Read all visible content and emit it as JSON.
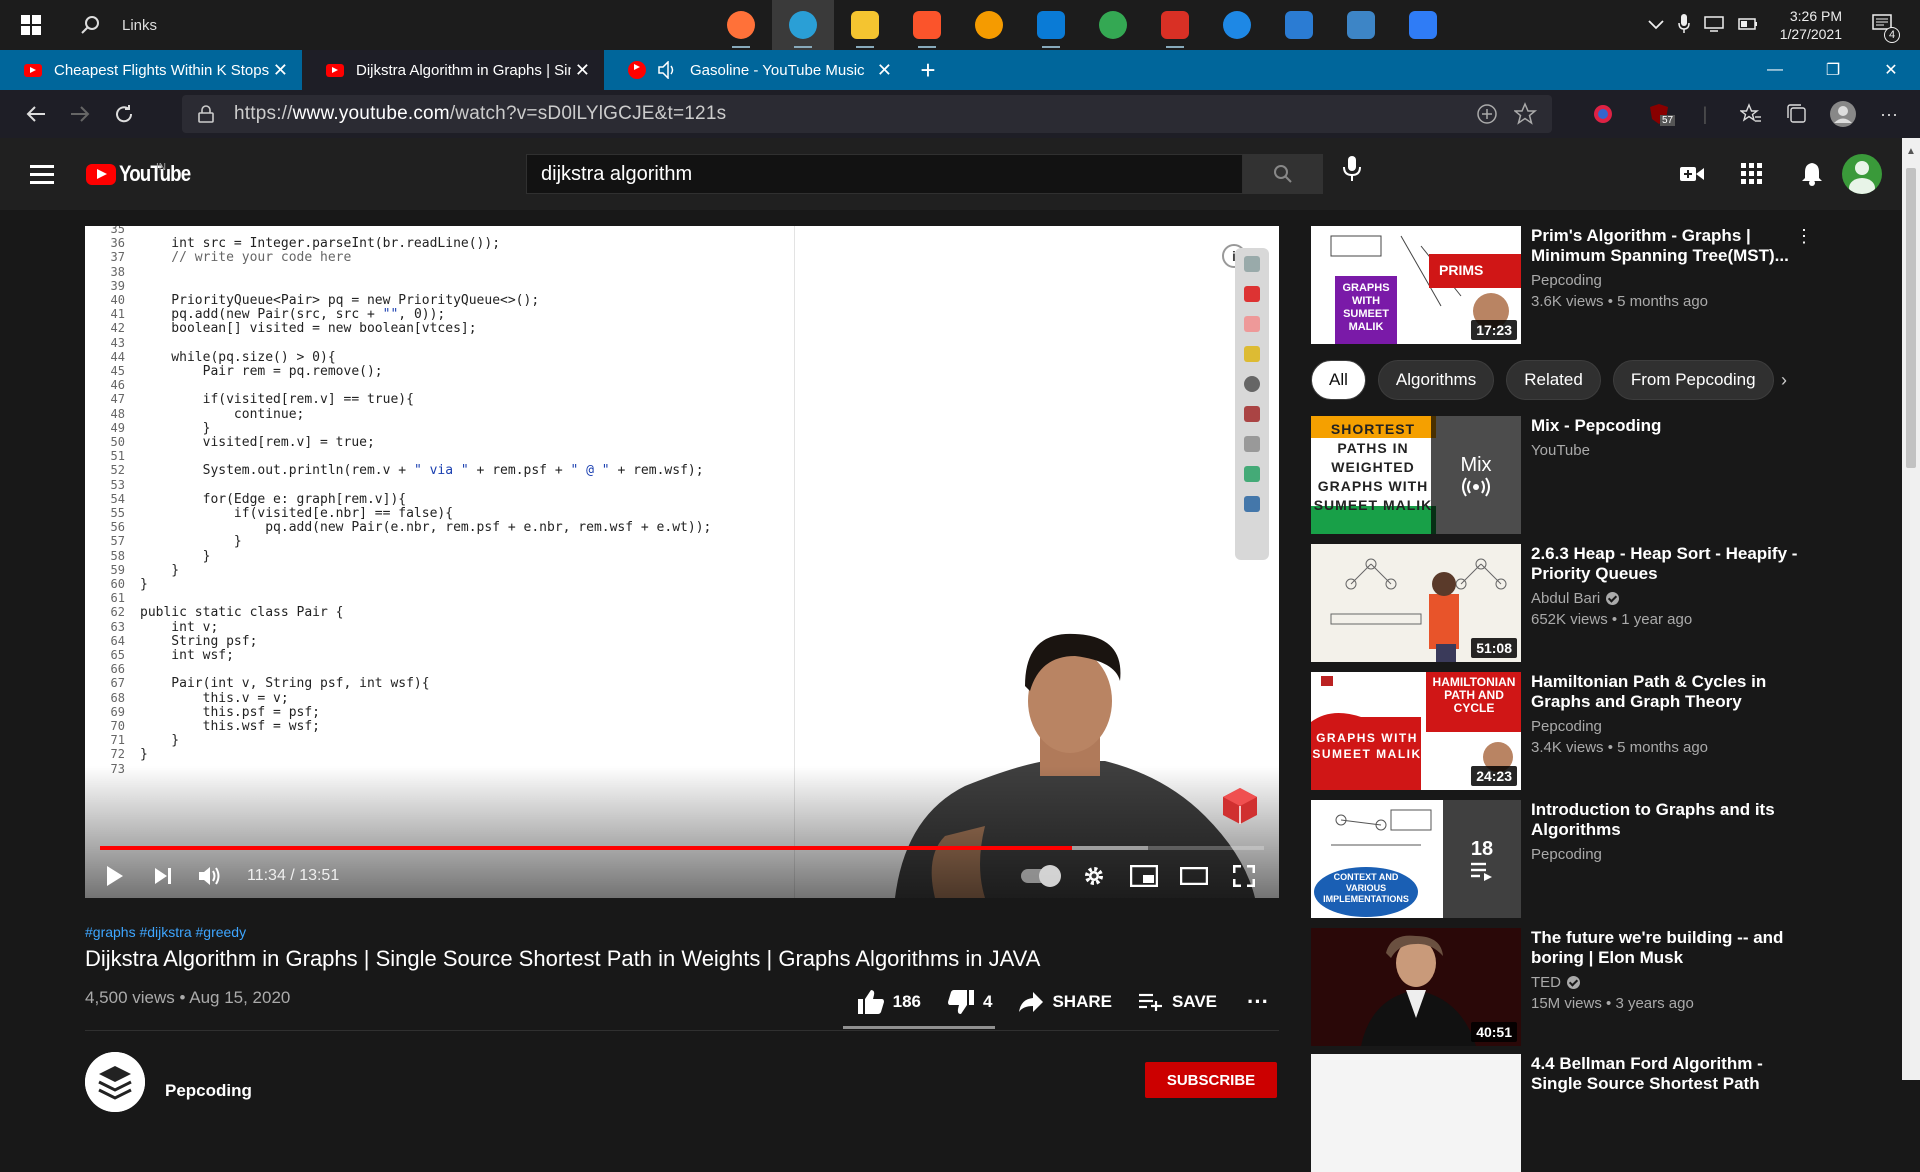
{
  "taskbar": {
    "search_label": "Links",
    "apps": [
      {
        "icon": "firefox-icon",
        "color": "#ff7139",
        "active": false,
        "running": true
      },
      {
        "icon": "edge-icon",
        "color": "#2a9fd6",
        "active": true,
        "running": true
      },
      {
        "icon": "file-explorer-icon",
        "color": "#f4c430",
        "active": false,
        "running": true
      },
      {
        "icon": "brave-icon",
        "color": "#fb542b",
        "active": false,
        "running": true
      },
      {
        "icon": "c-app-icon",
        "color": "#f59b00",
        "active": false,
        "running": false
      },
      {
        "icon": "vscode-icon",
        "color": "#0a7bd6",
        "active": false,
        "running": true
      },
      {
        "icon": "send-app-icon",
        "color": "#34a853",
        "active": false,
        "running": false
      },
      {
        "icon": "gmail-icon",
        "color": "#d93025",
        "active": false,
        "running": true
      },
      {
        "icon": "browser-globe-icon",
        "color": "#1e88e5",
        "active": false,
        "running": false
      },
      {
        "icon": "word-icon",
        "color": "#2b7cd3",
        "active": false,
        "running": false
      },
      {
        "icon": "photos-icon",
        "color": "#3d85c6",
        "active": false,
        "running": false
      },
      {
        "icon": "todo-icon",
        "color": "#2f7cf6",
        "active": false,
        "running": false
      }
    ],
    "time": "3:26 PM",
    "date": "1/27/2021",
    "notification_count": "4"
  },
  "browser": {
    "tabs": [
      {
        "title": "Cheapest Flights Within K Stops",
        "active": false,
        "audio": false
      },
      {
        "title": "Dijkstra Algorithm in Graphs | Sin",
        "active": true,
        "audio": false
      },
      {
        "title": "Gasoline - YouTube Music",
        "active": false,
        "audio": true
      }
    ],
    "url_prefix": "https://",
    "url_host": "www.youtube.com",
    "url_rest": "/watch?v=sD0lLYlGCJE&t=121s",
    "extension_badge": "57"
  },
  "youtube": {
    "logo_text": "YouTube",
    "region": "IN",
    "search_value": "dijkstra algorithm"
  },
  "player": {
    "current_time": "11:34",
    "duration": "13:51",
    "time_display": "11:34 / 13:51",
    "progress": 0.835,
    "code_lines": [
      {
        "n": "35",
        "t": ""
      },
      {
        "n": "36",
        "t": "    int src = Integer.parseInt(br.readLine());"
      },
      {
        "n": "37",
        "t": "    // write your code here"
      },
      {
        "n": "38",
        "t": ""
      },
      {
        "n": "39",
        "t": ""
      },
      {
        "n": "40",
        "t": "    PriorityQueue<Pair> pq = new PriorityQueue<>();"
      },
      {
        "n": "41",
        "t": "    pq.add(new Pair(src, src + \"\", 0));"
      },
      {
        "n": "42",
        "t": "    boolean[] visited = new boolean[vtces];"
      },
      {
        "n": "43",
        "t": ""
      },
      {
        "n": "44",
        "t": "    while(pq.size() > 0){"
      },
      {
        "n": "45",
        "t": "        Pair rem = pq.remove();"
      },
      {
        "n": "46",
        "t": ""
      },
      {
        "n": "47",
        "t": "        if(visited[rem.v] == true){"
      },
      {
        "n": "48",
        "t": "            continue;"
      },
      {
        "n": "49",
        "t": "        }"
      },
      {
        "n": "50",
        "t": "        visited[rem.v] = true;"
      },
      {
        "n": "51",
        "t": ""
      },
      {
        "n": "52",
        "t": "        System.out.println(rem.v + \" via \" + rem.psf + \" @ \" + rem.wsf);"
      },
      {
        "n": "53",
        "t": ""
      },
      {
        "n": "54",
        "t": "        for(Edge e: graph[rem.v]){"
      },
      {
        "n": "55",
        "t": "            if(visited[e.nbr] == false){"
      },
      {
        "n": "56",
        "t": "                pq.add(new Pair(e.nbr, rem.psf + e.nbr, rem.wsf + e.wt));"
      },
      {
        "n": "57",
        "t": "            }"
      },
      {
        "n": "58",
        "t": "        }"
      },
      {
        "n": "59",
        "t": "    }"
      },
      {
        "n": "60",
        "t": "}"
      },
      {
        "n": "61",
        "t": ""
      },
      {
        "n": "62",
        "t": "public static class Pair {"
      },
      {
        "n": "63",
        "t": "    int v;"
      },
      {
        "n": "64",
        "t": "    String psf;"
      },
      {
        "n": "65",
        "t": "    int wsf;"
      },
      {
        "n": "66",
        "t": ""
      },
      {
        "n": "67",
        "t": "    Pair(int v, String psf, int wsf){"
      },
      {
        "n": "68",
        "t": "        this.v = v;"
      },
      {
        "n": "69",
        "t": "        this.psf = psf;"
      },
      {
        "n": "70",
        "t": "        this.wsf = wsf;"
      },
      {
        "n": "71",
        "t": "    }"
      },
      {
        "n": "72",
        "t": "}"
      },
      {
        "n": "73",
        "t": ""
      }
    ]
  },
  "video": {
    "hashtags": "#graphs #dijkstra #greedy",
    "title": "Dijkstra Algorithm in Graphs | Single Source Shortest Path in Weights | Graphs Algorithms in JAVA",
    "views_date": "4,500 views • Aug 15, 2020",
    "likes": "186",
    "dislikes": "4",
    "share_label": "SHARE",
    "save_label": "SAVE",
    "channel": "Pepcoding",
    "subscribe_label": "SUBSCRIBE"
  },
  "sidebar": {
    "chips": [
      "All",
      "Algorithms",
      "Related",
      "From Pepcoding"
    ],
    "recommendations": [
      {
        "title": "Prim's Algorithm - Graphs | Minimum Spanning Tree(MST)...",
        "channel": "Pepcoding",
        "verified": false,
        "meta": "3.6K views • 5 months ago",
        "duration": "17:23",
        "thumb_text": "PRIMS",
        "thumb_label": "GRAPHS WITH SUMEET MALIK"
      },
      {
        "title": "Mix - Pepcoding",
        "channel": "YouTube",
        "verified": false,
        "meta": "",
        "duration": "",
        "thumb_text": "SHORTEST PATHS IN WEIGHTED GRAPHS WITH SUMEET MALIK",
        "overlay": "Mix"
      },
      {
        "title": "2.6.3 Heap - Heap Sort - Heapify - Priority Queues",
        "channel": "Abdul Bari",
        "verified": true,
        "meta": "652K views • 1 year ago",
        "duration": "51:08"
      },
      {
        "title": "Hamiltonian Path & Cycles in Graphs and Graph Theory",
        "channel": "Pepcoding",
        "verified": false,
        "meta": "3.4K views • 5 months ago",
        "duration": "24:23",
        "thumb_text": "HAMILTONIAN PATH AND CYCLE",
        "thumb_label": "GRAPHS WITH SUMEET MALIK"
      },
      {
        "title": "Introduction to Graphs and its Algorithms",
        "channel": "Pepcoding",
        "verified": false,
        "meta": "",
        "duration": "",
        "overlay": "18",
        "thumb_text": "CONTEXT AND VARIOUS IMPLEMENTATIONS"
      },
      {
        "title": "The future we're building -- and boring | Elon Musk",
        "channel": "TED",
        "verified": true,
        "meta": "15M views • 3 years ago",
        "duration": "40:51"
      },
      {
        "title": "4.4 Bellman Ford Algorithm - Single Source Shortest Path",
        "channel": "",
        "verified": false,
        "meta": "",
        "duration": ""
      }
    ]
  }
}
